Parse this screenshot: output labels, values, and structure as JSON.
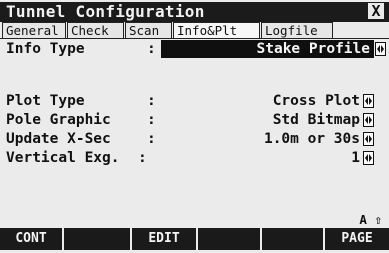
{
  "window": {
    "title": "Tunnel Configuration",
    "close_label": "X"
  },
  "tabs": [
    {
      "label": "General",
      "active": false
    },
    {
      "label": "Check",
      "active": false
    },
    {
      "label": "Scan",
      "active": false
    },
    {
      "label": "Info&Plt",
      "active": true
    },
    {
      "label": "Logfile",
      "active": false
    }
  ],
  "info": {
    "label": "Info Type",
    "value": "Stake Profile"
  },
  "fields": [
    {
      "label": "Plot Type",
      "value": "Cross Plot"
    },
    {
      "label": "Pole Graphic",
      "value": "Std Bitmap"
    },
    {
      "label": "Update X-Sec",
      "value": "1.0m or 30s"
    },
    {
      "label": "Vertical Exg.",
      "value": "1"
    }
  ],
  "colon": ":",
  "status": {
    "mode": "A ⇧"
  },
  "function_keys": [
    "CONT",
    "",
    "EDIT",
    "",
    "",
    "PAGE"
  ]
}
